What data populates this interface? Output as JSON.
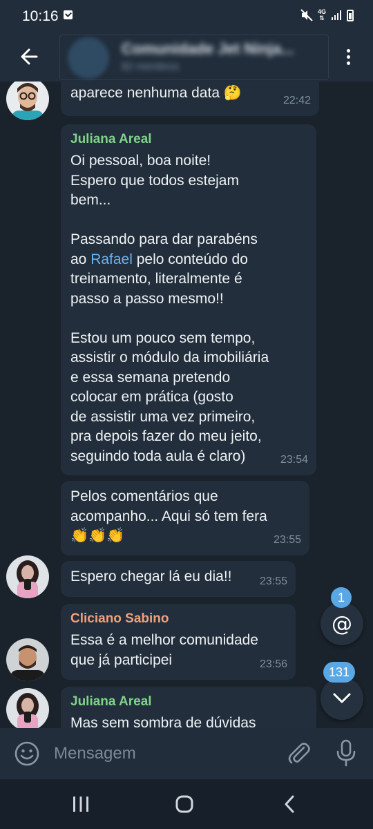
{
  "status_bar": {
    "time": "10:16",
    "network": "4G"
  },
  "header": {
    "title": "Comunidade Jet Ninja...",
    "subtitle": "82 membros"
  },
  "messages": [
    {
      "text": "aparece nenhuma data 🤔",
      "time": "22:42"
    },
    {
      "sender": "Juliana Areal",
      "sender_color": "#7fd48a",
      "text_before": "Oi pessoal, boa noite!\nEspero que todos estejam\nbem...\n\nPassando para dar parabéns\nao ",
      "mention": "Rafael",
      "text_after": " pelo conteúdo do\ntreinamento, literalmente é\npasso a passo mesmo!!\n\nEstou um pouco sem tempo,\nassistir o módulo da imobiliária\ne essa semana pretendo\ncolocar em prática (gosto\nde assistir uma vez primeiro,\npra depois fazer do meu jeito,\nseguindo toda aula é claro)",
      "time": "23:54"
    },
    {
      "text": "Pelos comentários que\nacompanho... Aqui só tem fera\n👏👏👏",
      "time": "23:55"
    },
    {
      "text": "Espero chegar lá eu dia!!",
      "time": "23:55"
    },
    {
      "sender": "Cliciano Sabino",
      "sender_color": "#f1a07a",
      "text": "Essa é a melhor comunidade\nque já participei",
      "time": "23:56"
    },
    {
      "sender": "Juliana Areal",
      "sender_color": "#7fd48a",
      "text": "Mas sem sombra de dúvidas"
    }
  ],
  "mention_badge": "1",
  "unread_badge": "131",
  "input": {
    "placeholder": "Mensagem"
  },
  "colors": {
    "bubble": "#222e3b",
    "accent": "#5aa7e4",
    "link": "#6ab3f3"
  }
}
